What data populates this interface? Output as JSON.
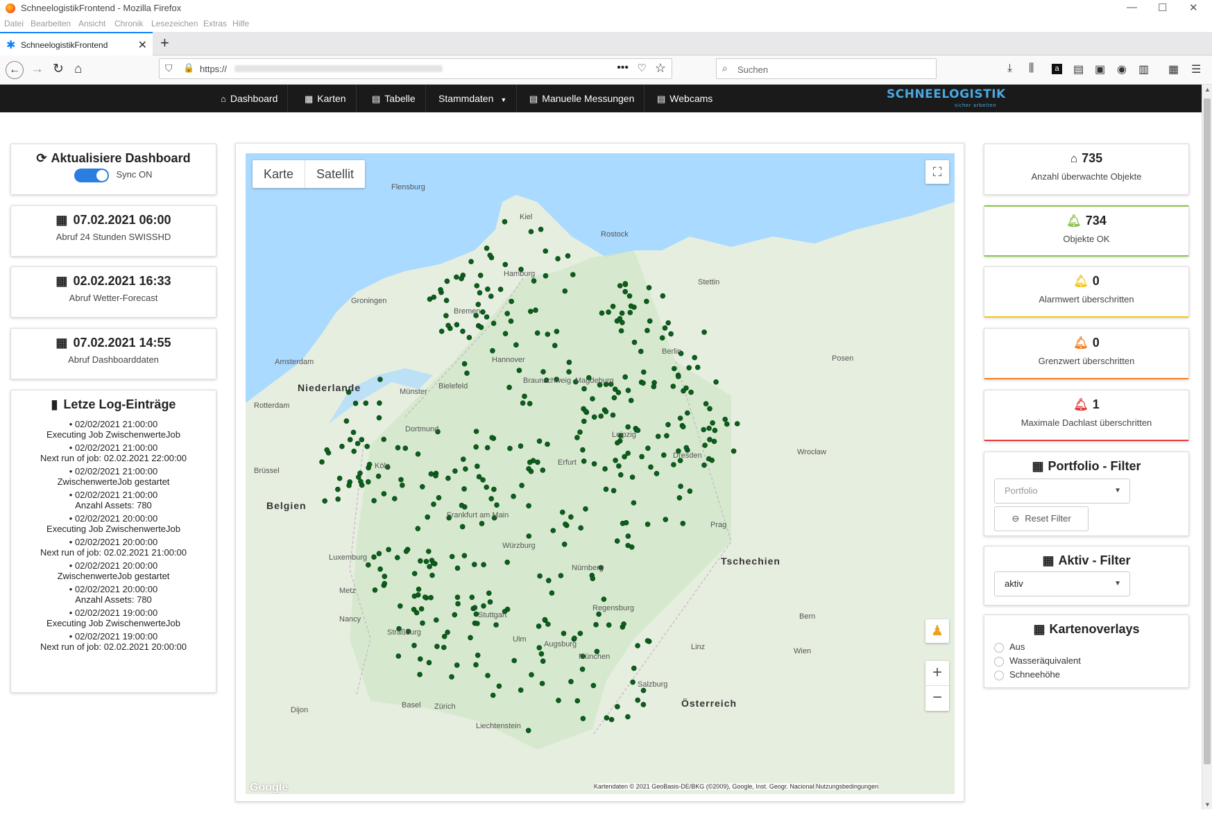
{
  "browser": {
    "window_title": "SchneelogistikFrontend - Mozilla Firefox",
    "menu": [
      "Datei",
      "Bearbeiten",
      "Ansicht",
      "Chronik",
      "Lesezeichen",
      "Extras",
      "Hilfe"
    ],
    "tab_title": "SchneelogistikFrontend",
    "url_prefix": "https://",
    "search_placeholder": "Suchen"
  },
  "appnav": {
    "items": [
      "Dashboard",
      "Karten",
      "Tabelle",
      "Stammdaten",
      "Manuelle Messungen",
      "Webcams"
    ],
    "brand": "SCHNEELOGISTIK",
    "brand_tag": "sicher arbeiten"
  },
  "left": {
    "sync_title": "Aktualisiere Dashboard",
    "sync_label": "Sync ON",
    "sync_on": true,
    "cards": [
      {
        "date": "07.02.2021 06:00",
        "label": "Abruf 24 Stunden SWISSHD"
      },
      {
        "date": "02.02.2021 16:33",
        "label": "Abruf Wetter-Forecast"
      },
      {
        "date": "07.02.2021 14:55",
        "label": "Abruf Dashboarddaten"
      }
    ],
    "log_title": "Letze Log-Einträge",
    "log": [
      {
        "time": "02/02/2021 21:00:00",
        "msg": "Executing Job ZwischenwerteJob"
      },
      {
        "time": "02/02/2021 21:00:00",
        "msg": "Next run of job: 02.02.2021 22:00:00"
      },
      {
        "time": "02/02/2021 21:00:00",
        "msg": "ZwischenwerteJob gestartet"
      },
      {
        "time": "02/02/2021 21:00:00",
        "msg": "Anzahl Assets: 780"
      },
      {
        "time": "02/02/2021 20:00:00",
        "msg": "Executing Job ZwischenwerteJob"
      },
      {
        "time": "02/02/2021 20:00:00",
        "msg": "Next run of job: 02.02.2021 21:00:00"
      },
      {
        "time": "02/02/2021 20:00:00",
        "msg": "ZwischenwerteJob gestartet"
      },
      {
        "time": "02/02/2021 20:00:00",
        "msg": "Anzahl Assets: 780"
      },
      {
        "time": "02/02/2021 19:00:00",
        "msg": "Executing Job ZwischenwerteJob"
      },
      {
        "time": "02/02/2021 19:00:00",
        "msg": "Next run of job: 02.02.2021 20:00:00"
      }
    ]
  },
  "map": {
    "type_buttons": [
      "Karte",
      "Satellit"
    ],
    "attribution": "Kartendaten © 2021 GeoBasis-DE/BKG (©2009), Google, Inst. Geogr. Nacional",
    "terms": "Nutzungsbedingungen",
    "logo": "Google",
    "labels": [
      "Niederlande",
      "Belgien",
      "Tschechien",
      "Österreich",
      "Hamburg",
      "Berlin",
      "Bremen",
      "Kiel",
      "Hannover",
      "Leipzig",
      "Dresden",
      "Köln",
      "Frankfurt am Main",
      "Stuttgart",
      "München",
      "Nürnberg",
      "Amsterdam",
      "Prag",
      "Wien",
      "Zürich",
      "Stettin",
      "Posen",
      "Wrocław",
      "Flensburg",
      "Rostock",
      "Dortmund",
      "Bielefeld",
      "Münster",
      "Magdeburg",
      "Braunschweig",
      "Erfurt",
      "Würzburg",
      "Augsburg",
      "Regensburg",
      "Ulm",
      "Linz",
      "Salzburg",
      "Brüssel",
      "Luxemburg",
      "Straßburg",
      "Basel",
      "Bern",
      "Rotterdam",
      "Groningen",
      "Dijon",
      "Metz",
      "Nancy",
      "Liechtenstein"
    ]
  },
  "stats": [
    {
      "value": "735",
      "label": "Anzahl überwachte Objekte",
      "icon": "home-icon",
      "color": "#222222"
    },
    {
      "value": "734",
      "label": "Objekte OK",
      "icon": "bell-icon",
      "color": "#8bc34a"
    },
    {
      "value": "0",
      "label": "Alarmwert überschritten",
      "icon": "bell-icon",
      "color": "#f5c518"
    },
    {
      "value": "0",
      "label": "Grenzwert überschritten",
      "icon": "bell-icon",
      "color": "#f57c20"
    },
    {
      "value": "1",
      "label": "Maximale Dachlast überschritten",
      "icon": "bell-icon",
      "color": "#e53935"
    }
  ],
  "filters": {
    "portfolio_title": "Portfolio - Filter",
    "portfolio_placeholder": "Portfolio",
    "reset_label": "Reset Filter",
    "aktiv_title": "Aktiv - Filter",
    "aktiv_value": "aktiv",
    "overlay_title": "Kartenoverlays",
    "overlays": [
      "Aus",
      "Wasseräquivalent",
      "Schneehöhe"
    ]
  }
}
